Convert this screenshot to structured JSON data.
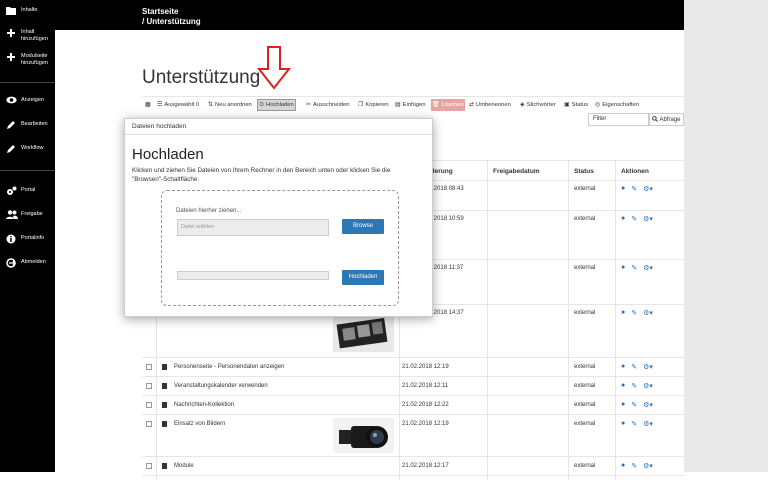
{
  "sidebar": {
    "items": [
      {
        "label": "Inhalte",
        "icon": "folder-icon"
      },
      {
        "label": "Inhalt\nhinzufügen",
        "icon": "plus-icon"
      },
      {
        "label": "Modulseite\nhinzufügen",
        "icon": "plus-icon"
      },
      {
        "label": "Anzeigen",
        "icon": "eye-icon"
      },
      {
        "label": "Bearbeiten",
        "icon": "pencil-icon"
      },
      {
        "label": "Workflow",
        "icon": "pencil-icon"
      },
      {
        "label": "Portal",
        "icon": "gears-icon"
      },
      {
        "label": "Freigabe",
        "icon": "users-icon"
      },
      {
        "label": "Portalinfo",
        "icon": "info-icon"
      },
      {
        "label": "Abmelden",
        "icon": "logout-icon"
      }
    ]
  },
  "breadcrumb": {
    "line1": "Startseite",
    "line2": "/ Unterstützung"
  },
  "page": {
    "title": "Unterstützung"
  },
  "toolbar": {
    "grid": "▦",
    "selected": "Ausgewählt 0",
    "reorder": "Neu anordnen",
    "upload": "Hochladen",
    "cut": "Ausschneiden",
    "copy": "Kopieren",
    "paste": "Einfügen",
    "delete": "Löschen",
    "rename": "Umbenennen",
    "keywords": "Stichwörter",
    "status": "Status",
    "properties": "Eigenschaften"
  },
  "filter": {
    "placeholder": "Filter",
    "button": "Abfrage"
  },
  "table": {
    "headers": {
      "modified": "Änderung",
      "release": "Freigabedatum",
      "status": "Status",
      "actions": "Aktionen"
    },
    "rows": [
      {
        "title": "",
        "date": "21.02.2018 08:43",
        "status": "external"
      },
      {
        "title": "",
        "date": "21.02.2018 10:59",
        "status": "external"
      },
      {
        "title": "",
        "date": "21.02.2018 11:37",
        "status": "external"
      },
      {
        "title": "",
        "date": "21.02.2018 14:37",
        "status": "external"
      },
      {
        "title": "Personenseite - Personendaten anzeigen",
        "date": "21.02.2018 12:19",
        "status": "external"
      },
      {
        "title": "Veranstaltungskalender verwenden",
        "date": "21.02.2018 12:11",
        "status": "external"
      },
      {
        "title": "Nachrichten-Kollektion",
        "date": "21.02.2018 12:22",
        "status": "external"
      },
      {
        "title": "Einsatz von Bildern",
        "date": "21.02.2018 12:19",
        "status": "external"
      },
      {
        "title": "Module",
        "date": "21.02.2018 12:17",
        "status": "external"
      }
    ]
  },
  "modal": {
    "header": "Dateien hochladen",
    "title": "Hochladen",
    "description": "Klicken und ziehen Sie Dateien von Ihrem Rechner in den Bereich unten oder klicken Sie die \"Browsen\"-Schaltfläche.",
    "drop_hint": "Dateien hierher ziehen...",
    "file_placeholder": "Datei wählen",
    "browse": "Browse",
    "upload": "Hochladen"
  },
  "colors": {
    "accent": "#2c77b4",
    "danger": "#e8a4a3",
    "arrow": "#e02020"
  }
}
